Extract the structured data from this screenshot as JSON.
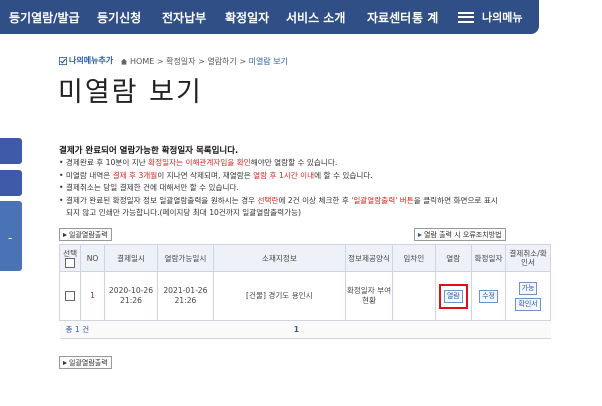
{
  "nav": {
    "items": [
      "등기열람/발급",
      "등기신청",
      "전자납부",
      "확정일자",
      "서비스 소개",
      "자료센터",
      "통 계"
    ],
    "menu_label": "나의메뉴"
  },
  "breadcrumb": {
    "mymenu_label": "나의메뉴추가",
    "home": "HOME",
    "path1": "확정일자",
    "path2": "열람하기",
    "current": "미열람 보기"
  },
  "page_title": "미열람 보기",
  "notice": {
    "title": "결제가 완료되어 열람가능한 확정일자 목록입니다.",
    "b1_pre": "경제완료 후 10분이 지난 ",
    "b1_red": "확정일자는 이해관계자임을 확인",
    "b1_post": "해야만 열람할 수 있습니다.",
    "b2_pre": "미열람 내역은 ",
    "b2_red1": "결제 후 3개월",
    "b2_mid": "이 지나면 삭제되며, 재열람은 ",
    "b2_red2": "열람 후 1시간 이내",
    "b2_post": "에 할 수 있습니다.",
    "b3": "결제취소는 당일 결제한 건에 대해서만 할 수 있습니다.",
    "b4_pre": "결제가 완료된 확정일자 정보 일괄열람출력을 원하시는 경우 ",
    "b4_red1": "선택란",
    "b4_mid": "에 2건 이상 체크한 후 ",
    "b4_red2": "'일괄열람출력' 버튼",
    "b4_post": "을 클릭하면 화면으로 표시",
    "b4_line2": "되지 않고 인쇄만 가능합니다.(페이지당 최대 10건까지 일괄열람출력가능)"
  },
  "buttons": {
    "batch_print": "일괄열람출력",
    "troubleshoot": "열람 출력 시 오류조치방법"
  },
  "table": {
    "headers": {
      "select": "선택",
      "no": "NO",
      "pay_date": "결제일시",
      "view_date": "열람가능일시",
      "address": "소재지정보",
      "info_type": "정보제공양식",
      "lessee": "임차인",
      "view": "열람",
      "fixed_date": "확정일자",
      "cancel": "결제취소/확인서"
    },
    "rows": [
      {
        "no": "1",
        "pay_date": "2020-10-26 21:26",
        "view_date": "2021-01-26 21:26",
        "address": "[건물] 경기도 용인시",
        "info_type": "확정일자 부여현황",
        "lessee": "",
        "view_btn": "열람",
        "fixed_btn": "수정",
        "cancel_btn": "가능",
        "confirm_btn": "확인서"
      }
    ],
    "total": "총 1 건",
    "page": "1"
  }
}
